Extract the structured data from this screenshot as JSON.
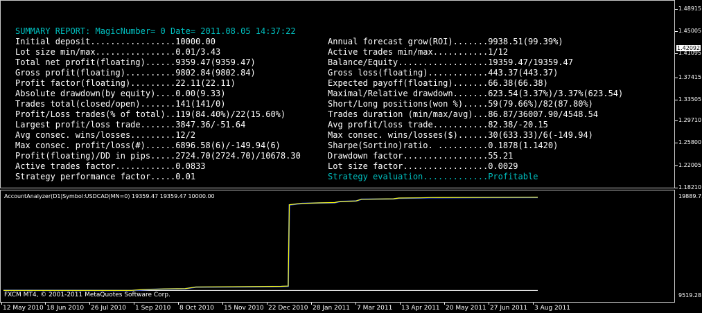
{
  "header": {
    "title": "SUMMARY REPORT: MagicNumber= 0 Date= 2011.08.05 14:37:22"
  },
  "report_left": [
    {
      "label": "Initial deposit.................",
      "value": "10000.00"
    },
    {
      "label": "Lot size min/max................",
      "value": "0.01/3.43"
    },
    {
      "label": "Total net profit(floating)......",
      "value": "9359.47(9359.47)"
    },
    {
      "label": "Gross profit(floating)..........",
      "value": "9802.84(9802.84)"
    },
    {
      "label": "Profit factor(floating).........",
      "value": "22.11(22.11)"
    },
    {
      "label": "Absolute drawdown(by equity)....",
      "value": "0.00(9.33)"
    },
    {
      "label": "Trades total(closed/open).......",
      "value": "141(141/0)"
    },
    {
      "label": "Profit/Loss trades(% of total)..",
      "value": "119(84.40%)/22(15.60%)"
    },
    {
      "label": "Largest profit/loss trade.......",
      "value": "3847.36/-51.64"
    },
    {
      "label": "Avg consec. wins/losses.........",
      "value": "12/2"
    },
    {
      "label": "Max consec. profit/loss(#)......",
      "value": "6896.58(6)/-149.94(6)"
    },
    {
      "label": "Profit(floating)/DD in pips.....",
      "value": "2724.70(2724.70)/10678.30"
    },
    {
      "label": "Active trades factor............",
      "value": "0.0833"
    },
    {
      "label": "Strategy performance factor.....",
      "value": "0.01"
    }
  ],
  "report_right": [
    {
      "label": "Annual forecast grow(ROI).......",
      "value": "9938.51(99.39%)"
    },
    {
      "label": "Active trades min/max...........",
      "value": "1/12"
    },
    {
      "label": "Balance/Equity..................",
      "value": "19359.47/19359.47"
    },
    {
      "label": "Gross loss(floating)............",
      "value": "443.37(443.37)"
    },
    {
      "label": "Expected payoff(floating).......",
      "value": "66.38(66.38)"
    },
    {
      "label": "Maximal/Relative drawdown.......",
      "value": "623.54(3.37%)/3.37%(623.54)"
    },
    {
      "label": "Short/Long positions(won %).....",
      "value": "59(79.66%)/82(87.80%)"
    },
    {
      "label": "Trades duration (min/max/avg)...",
      "value": "86.87/36007.90/4548.54"
    },
    {
      "label": "Avg profit/loss trade...........",
      "value": "82.38/-20.15"
    },
    {
      "label": "Max consec. wins/losses($)......",
      "value": "30(633.33)/6(-149.94)"
    },
    {
      "label": "Sharpe(Sortino)ratio. ..........",
      "value": "0.1878(1.1420)"
    },
    {
      "label": "Drawdown factor.................",
      "value": "55.21"
    },
    {
      "label": "Lot size factor.................",
      "value": "0.0029"
    },
    {
      "label": "Strategy evaluation.............",
      "value": "Profitable"
    }
  ],
  "price_axis": [
    "1.48915",
    "1.45005",
    "1.41095",
    "1.37415",
    "1.33505",
    "1.29710",
    "1.25800",
    "1.22005",
    "1.18210"
  ],
  "current_price": "1.42092",
  "indicator": {
    "label": "AccountAnalyzer(D1|Symbol:USDCAD|MN=0) 19359.47 19359.47 10000.00",
    "axis_top": "19889.75",
    "axis_bottom": "9519.28"
  },
  "copyright": "FXCM MT4, © 2001-2011 MetaQuotes Software Corp.",
  "time_axis": [
    "12 May 2010",
    "18 Jun 2010",
    "26 Jul 2010",
    "1 Sep 2010",
    "8 Oct 2010",
    "15 Nov 2010",
    "22 Dec 2010",
    "28 Jan 2011",
    "7 Mar 2011",
    "13 Apr 2011",
    "20 May 2011",
    "27 Jun 2011",
    "3 Aug 2011"
  ],
  "chart_data": {
    "type": "line",
    "ylim": [
      9519.28,
      19889.75
    ],
    "series": [
      {
        "color": "#ffff00",
        "values": [
          [
            0,
            10000
          ],
          [
            0.24,
            10000
          ],
          [
            0.26,
            10080
          ],
          [
            0.3,
            10150
          ],
          [
            0.34,
            10180
          ],
          [
            0.36,
            10350
          ],
          [
            0.45,
            10380
          ],
          [
            0.52,
            10420
          ],
          [
            0.533,
            10450
          ],
          [
            0.535,
            18900
          ],
          [
            0.55,
            19000
          ],
          [
            0.56,
            19050
          ],
          [
            0.59,
            19100
          ],
          [
            0.62,
            19130
          ],
          [
            0.63,
            19250
          ],
          [
            0.66,
            19300
          ],
          [
            0.67,
            19480
          ],
          [
            0.73,
            19520
          ],
          [
            0.74,
            19600
          ],
          [
            0.78,
            19620
          ],
          [
            0.8,
            19650
          ],
          [
            0.9,
            19660
          ],
          [
            1.0,
            19680
          ]
        ]
      },
      {
        "color": "#1e40ff",
        "values": [
          [
            0,
            10000
          ],
          [
            0.24,
            9990
          ],
          [
            0.26,
            10070
          ],
          [
            0.3,
            10140
          ],
          [
            0.34,
            10170
          ],
          [
            0.36,
            10340
          ],
          [
            0.45,
            10370
          ],
          [
            0.52,
            10400
          ],
          [
            0.533,
            10430
          ],
          [
            0.535,
            18880
          ],
          [
            0.55,
            18990
          ],
          [
            0.56,
            19040
          ],
          [
            0.59,
            19090
          ],
          [
            0.62,
            19120
          ],
          [
            0.63,
            19240
          ],
          [
            0.66,
            19290
          ],
          [
            0.67,
            19470
          ],
          [
            0.73,
            19510
          ],
          [
            0.74,
            19590
          ],
          [
            0.78,
            19610
          ],
          [
            0.8,
            19640
          ],
          [
            0.9,
            19650
          ],
          [
            1.0,
            19670
          ]
        ]
      }
    ],
    "baseline": 10000
  }
}
